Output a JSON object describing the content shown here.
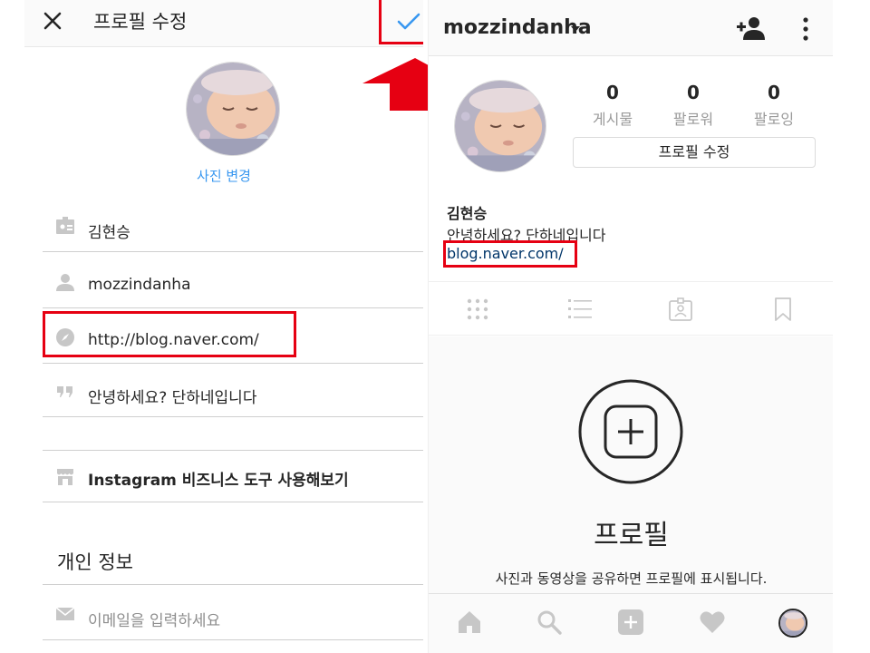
{
  "edit_screen": {
    "title": "프로필 수정",
    "change_photo_label": "사진 변경",
    "fields": {
      "name": "김현승",
      "username": "mozzindanha",
      "website": "http://blog.naver.com/",
      "bio": "안녕하세요? 단하네입니다",
      "business_tools": "Instagram 비즈니스 도구 사용해보기",
      "email_placeholder": "이메일을 입력하세요"
    },
    "personal_info_title": "개인 정보"
  },
  "profile_screen": {
    "username": "mozzindanha",
    "stats": [
      {
        "value": "0",
        "label": "게시물"
      },
      {
        "value": "0",
        "label": "팔로워"
      },
      {
        "value": "0",
        "label": "팔로잉"
      }
    ],
    "edit_profile_label": "프로필 수정",
    "bio": {
      "name": "김현승",
      "text": "안녕하세요? 단하네입니다",
      "link": "blog.naver.com/"
    },
    "empty_state": {
      "title": "프로필",
      "subtitle": "사진과 동영상을 공유하면 프로필에 표시됩니다."
    }
  },
  "icons": {
    "close": "close-icon",
    "confirm": "checkmark-icon",
    "tabs": [
      "grid-icon",
      "list-icon",
      "tagged-icon",
      "saved-icon"
    ],
    "nav": [
      "home-icon",
      "search-icon",
      "new-post-icon",
      "activity-icon",
      "profile-avatar"
    ]
  },
  "colors": {
    "accent": "#3897f0",
    "highlight": "#e60012",
    "link": "#003569"
  }
}
